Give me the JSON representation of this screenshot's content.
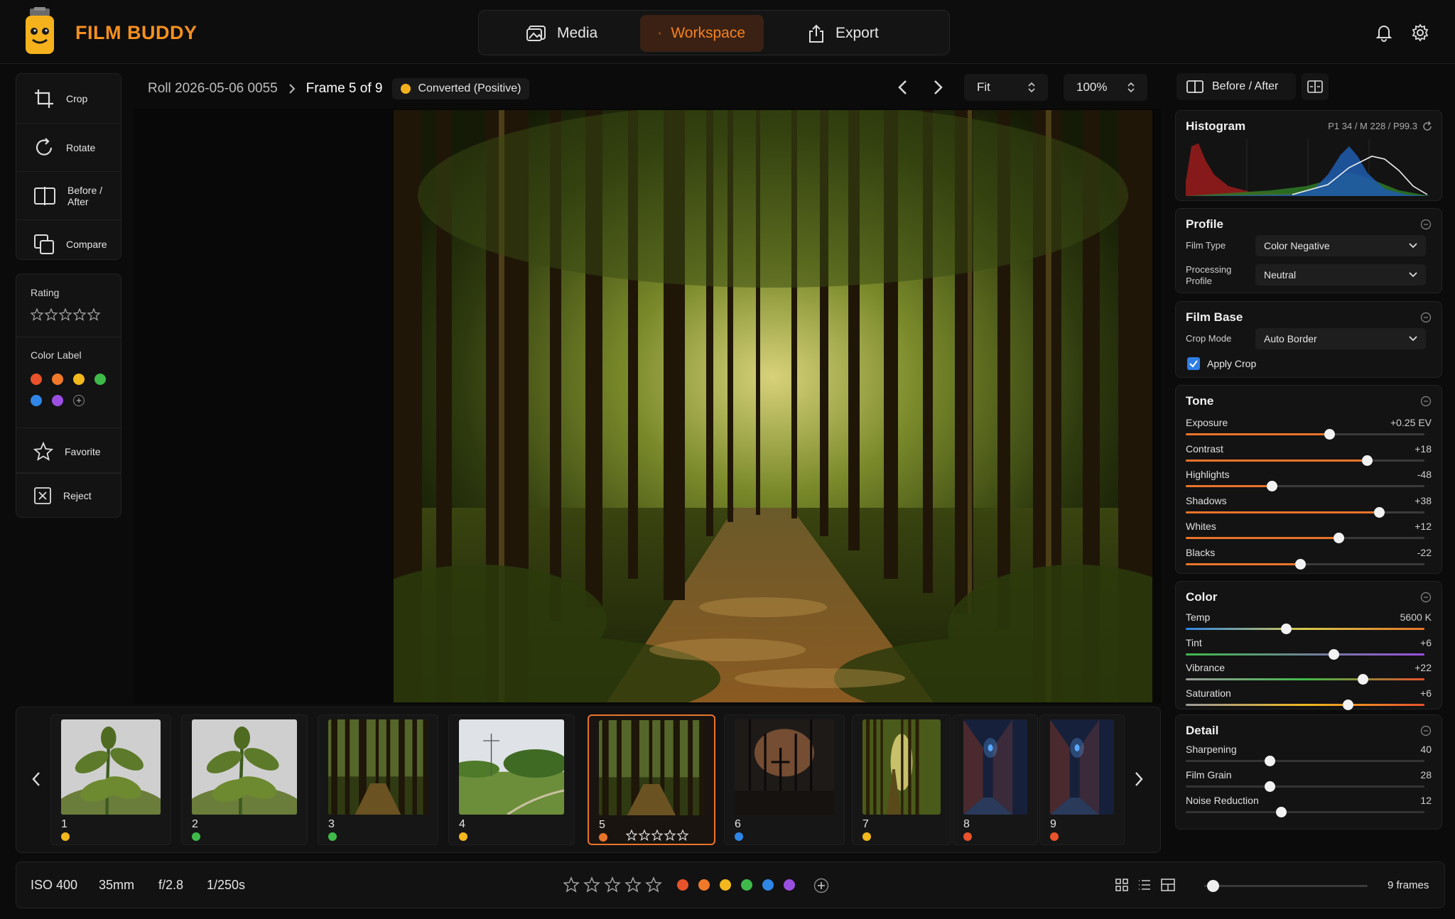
{
  "app": {
    "name": "FILM BUDDY"
  },
  "nav": {
    "tabs": [
      {
        "label": "Media",
        "icon": "media-icon"
      },
      {
        "label": "Workspace",
        "icon": "grid-icon",
        "active": true
      },
      {
        "label": "Export",
        "icon": "export-icon"
      }
    ]
  },
  "header": {
    "icons": [
      "bell-icon",
      "gear-icon"
    ]
  },
  "tools": [
    {
      "label": "Crop",
      "icon": "crop-icon"
    },
    {
      "label": "Rotate",
      "icon": "rotate-icon"
    },
    {
      "label": "Before / After",
      "icon": "split-icon"
    },
    {
      "label": "Compare",
      "icon": "compare-icon"
    }
  ],
  "sidebar": {
    "rating_label": "Rating",
    "color_label": "Color Label",
    "colors": [
      "#e8532b",
      "#f07a2a",
      "#f2b81e",
      "#3fba4a",
      "#2f86e6",
      "#9b4fe0"
    ],
    "favorite_label": "Favorite",
    "reject_label": "Reject"
  },
  "breadcrumb": {
    "roll": "Roll 2026-05-06 0055",
    "frame": "Frame 5 of 9",
    "status": "Converted (Positive)"
  },
  "viewer": {
    "fit": "Fit",
    "zoom": "100%"
  },
  "right": {
    "before_after": "Before / After",
    "histogram": {
      "title": "Histogram",
      "info": "P1 34 / M 228 / P99.3"
    },
    "profile": {
      "title": "Profile",
      "film_type_label": "Film Type",
      "film_type": "Color Negative",
      "processing_label": "Processing Profile",
      "processing": "Neutral"
    },
    "film_base": {
      "title": "Film Base",
      "crop_mode_label": "Crop Mode",
      "crop_mode": "Auto Border",
      "apply_crop": "Apply Crop",
      "apply_crop_checked": true
    },
    "tone": {
      "title": "Tone",
      "sliders": [
        {
          "name": "Exposure",
          "value": "+0.25 EV",
          "pos": 0.6
        },
        {
          "name": "Contrast",
          "value": "+18",
          "pos": 0.76
        },
        {
          "name": "Highlights",
          "value": "-48",
          "pos": 0.36
        },
        {
          "name": "Shadows",
          "value": "+38",
          "pos": 0.81
        },
        {
          "name": "Whites",
          "value": "+12",
          "pos": 0.64
        },
        {
          "name": "Blacks",
          "value": "-22",
          "pos": 0.48
        }
      ]
    },
    "color": {
      "title": "Color",
      "sliders": [
        {
          "name": "Temp",
          "value": "5600 K",
          "pos": 0.42
        },
        {
          "name": "Tint",
          "value": "+6",
          "pos": 0.62
        },
        {
          "name": "Vibrance",
          "value": "+22",
          "pos": 0.74
        },
        {
          "name": "Saturation",
          "value": "+6",
          "pos": 0.68
        }
      ]
    },
    "detail": {
      "title": "Detail",
      "sliders": [
        {
          "name": "Sharpening",
          "value": "40",
          "pos": 0.35
        },
        {
          "name": "Film Grain",
          "value": "28",
          "pos": 0.35
        },
        {
          "name": "Noise Reduction",
          "value": "12",
          "pos": 0.4
        }
      ]
    }
  },
  "filmstrip": {
    "frames": [
      {
        "num": "1",
        "dot": "#f2b81e",
        "scene": "plant"
      },
      {
        "num": "2",
        "dot": "#3fba4a",
        "scene": "plant"
      },
      {
        "num": "3",
        "dot": "#3fba4a",
        "scene": "forest"
      },
      {
        "num": "4",
        "dot": "#f2b81e",
        "scene": "field"
      },
      {
        "num": "5",
        "dot": "#e8742a",
        "scene": "forest",
        "selected": true
      },
      {
        "num": "6",
        "dot": "#2f86e6",
        "scene": "gate"
      },
      {
        "num": "7",
        "dot": "#f2b81e",
        "scene": "corridor"
      },
      {
        "num": "8",
        "dot": "#e8532b",
        "scene": "alley"
      },
      {
        "num": "9",
        "dot": "#e8532b",
        "scene": "alley"
      }
    ]
  },
  "bottom": {
    "iso": "ISO 400",
    "focal": "35mm",
    "aperture": "f/2.8",
    "shutter": "1/250s",
    "colors": [
      "#e8532b",
      "#f07a2a",
      "#f2b81e",
      "#3fba4a",
      "#2f86e6",
      "#9b4fe0"
    ],
    "frames_count": "9 frames",
    "zoom_slider": 0.05
  }
}
